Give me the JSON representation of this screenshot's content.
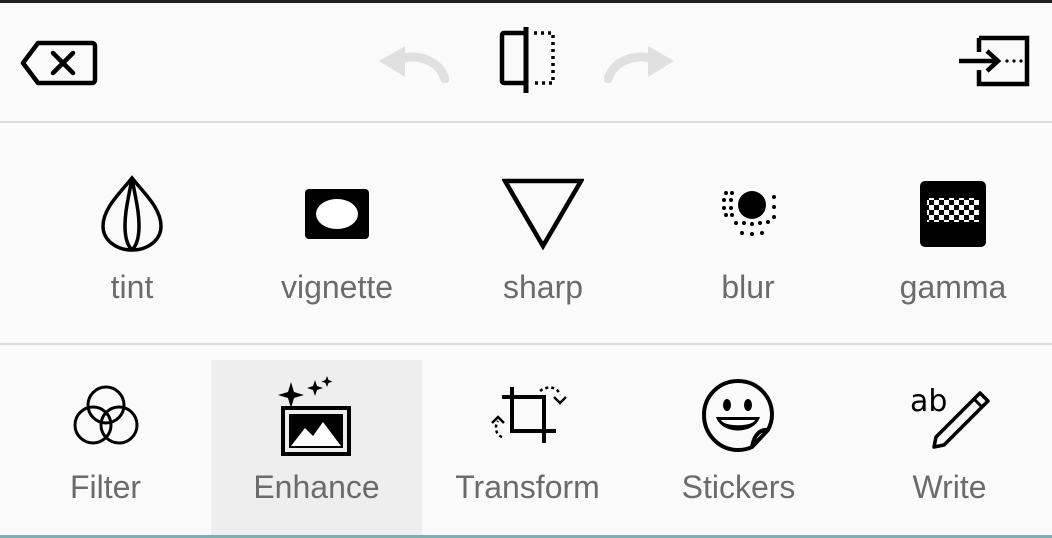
{
  "toolbar": {
    "buttons": [
      {
        "name": "backspace-icon",
        "enabled": true
      },
      {
        "name": "undo-icon",
        "enabled": false
      },
      {
        "name": "compare-icon",
        "enabled": true
      },
      {
        "name": "redo-icon",
        "enabled": false
      },
      {
        "name": "save-exit-icon",
        "enabled": true
      }
    ]
  },
  "tools": [
    {
      "label": "tint",
      "icon": "tint-icon"
    },
    {
      "label": "vignette",
      "icon": "vignette-icon"
    },
    {
      "label": "sharp",
      "icon": "sharp-icon"
    },
    {
      "label": "blur",
      "icon": "blur-icon"
    },
    {
      "label": "gamma",
      "icon": "gamma-icon"
    }
  ],
  "tabs": [
    {
      "label": "Filter",
      "icon": "filter-icon",
      "active": false
    },
    {
      "label": "Enhance",
      "icon": "enhance-icon",
      "active": true
    },
    {
      "label": "Transform",
      "icon": "transform-icon",
      "active": false
    },
    {
      "label": "Stickers",
      "icon": "stickers-icon",
      "active": false
    },
    {
      "label": "Write",
      "icon": "write-icon",
      "active": false
    }
  ],
  "colors": {
    "background": "#fafafa",
    "icon": "#000000",
    "icon_disabled": "#e0e0e0",
    "label": "#6b6b6b",
    "active_tab": "#eeeeee",
    "divider": "#dcdcdc",
    "accent_line": "#7aaeb0"
  }
}
